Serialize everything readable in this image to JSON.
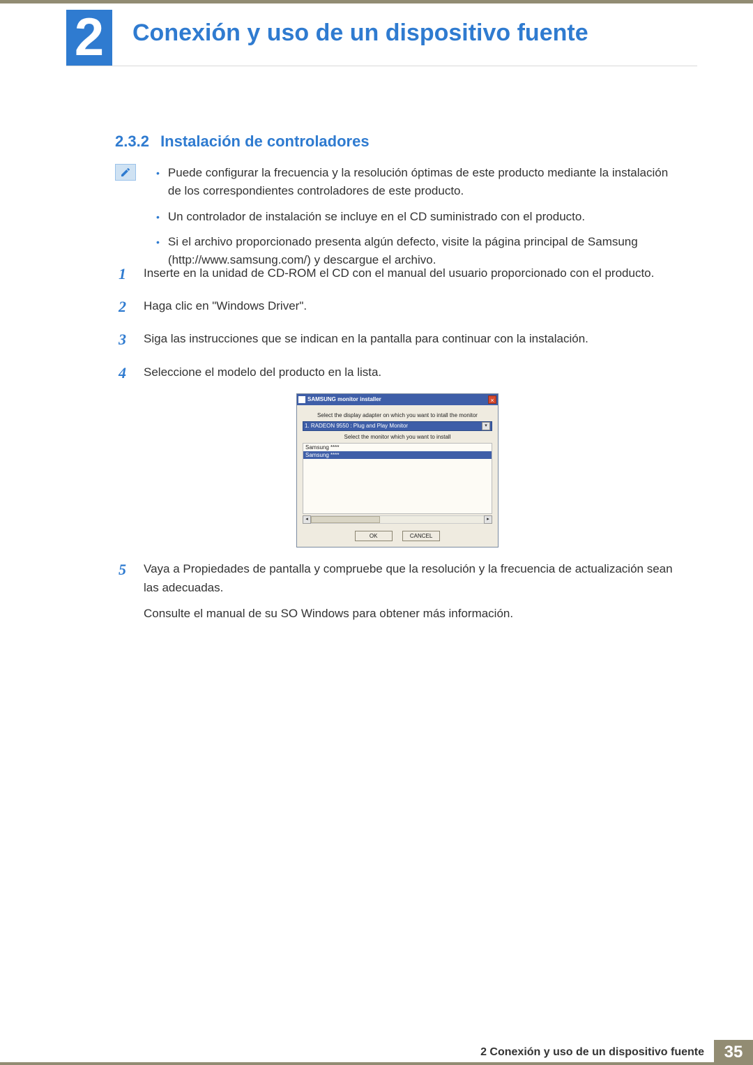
{
  "chapter": {
    "number": "2",
    "title": "Conexión y uso de un dispositivo fuente"
  },
  "section": {
    "number": "2.3.2",
    "title": "Instalación de controladores"
  },
  "notes": [
    "Puede configurar la frecuencia y la resolución óptimas de este producto mediante la instalación de los correspondientes controladores de este producto.",
    "Un controlador de instalación se incluye en el CD suministrado con el producto.",
    "Si el archivo proporcionado presenta algún defecto, visite la página principal de Samsung (http://www.samsung.com/) y descargue el archivo."
  ],
  "steps": {
    "s1": {
      "n": "1",
      "t": "Inserte en la unidad de CD-ROM el CD con el manual del usuario proporcionado con el producto."
    },
    "s2": {
      "n": "2",
      "t": "Haga clic en \"Windows Driver\"."
    },
    "s3": {
      "n": "3",
      "t": "Siga las instrucciones que se indican en la pantalla para continuar con la instalación."
    },
    "s4": {
      "n": "4",
      "t": "Seleccione el modelo del producto en la lista."
    },
    "s5": {
      "n": "5",
      "t": "Vaya a Propiedades de pantalla y compruebe que la resolución y la frecuencia de actualización sean las adecuadas."
    },
    "s5b": "Consulte el manual de su SO Windows para obtener más información."
  },
  "installer": {
    "title": "SAMSUNG monitor installer",
    "label1": "Select the display adapter on which you want to intall the monitor",
    "combo": "1. RADEON 9550 : Plug and Play Monitor",
    "label2": "Select the monitor which you want to install",
    "list": [
      "Samsung ****",
      "Samsung ****"
    ],
    "ok": "OK",
    "cancel": "CANCEL"
  },
  "footer": {
    "label": "2 Conexión y uso de un dispositivo fuente",
    "page": "35"
  }
}
